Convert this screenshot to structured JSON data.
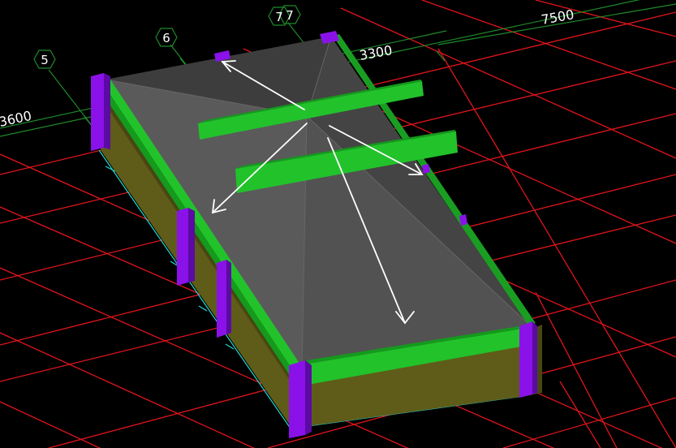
{
  "axes": [
    {
      "label": "5"
    },
    {
      "label": "6"
    },
    {
      "label": "7"
    },
    {
      "label": "7"
    }
  ],
  "dimensions": {
    "left_span": "3600",
    "mid_span": "3300",
    "right_span": "7500"
  },
  "colors": {
    "background": "#000000",
    "grid_red": "#e0151b",
    "grid_green": "#1f8a2a",
    "axis_circle": "#1f8a2a",
    "slab_dark": "#3b3b3b",
    "slab_mid": "#4d4d4d",
    "slab_light": "#5c5c5c",
    "beam_green": "#22c22b",
    "beam_dark": "#149a1c",
    "column_purple": "#8a12e8",
    "column_dark": "#5b0aa3",
    "wall_olive": "#5e5c18",
    "wall_dark": "#484612",
    "cyan_line": "#24d8d8",
    "arrow": "#ffffff",
    "text": "#ffffff"
  }
}
